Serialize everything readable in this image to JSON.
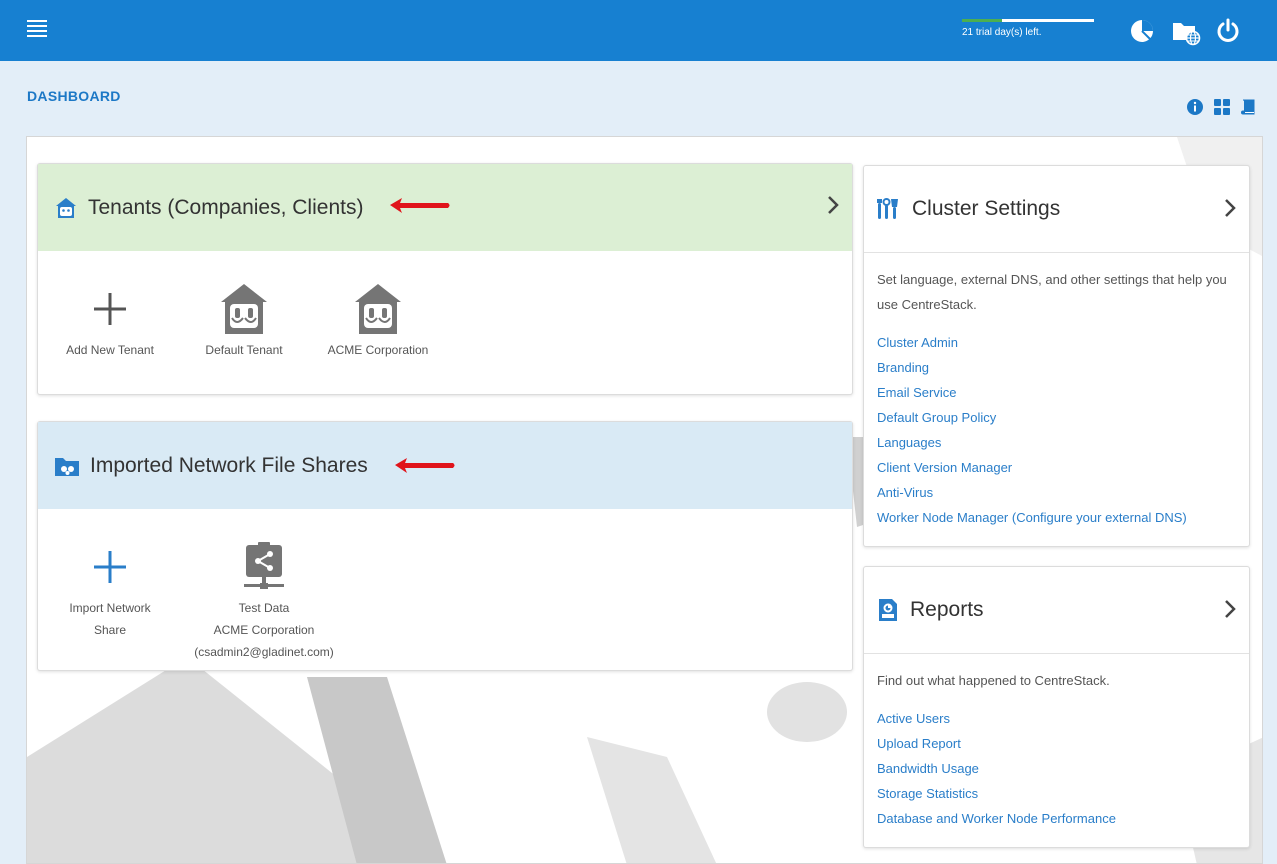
{
  "topbar": {
    "menu_icon": "hamburger-menu-icon",
    "trial_text": "21 trial day(s) left.",
    "trial_progress": 0.3,
    "icons": [
      "pie-chart-icon",
      "folder-globe-icon",
      "power-icon"
    ]
  },
  "page": {
    "title": "DASHBOARD",
    "view_icons": [
      "info-icon",
      "grid-view-icon",
      "book-icon"
    ]
  },
  "tenants": {
    "title": "Tenants (Companies, Clients)",
    "header_color": "#dcefd4",
    "tiles": [
      {
        "label": "Add New Tenant",
        "icon": "plus-icon"
      },
      {
        "label": "Default Tenant",
        "icon": "tenant-house-icon"
      },
      {
        "label": "ACME Corporation",
        "icon": "tenant-house-icon"
      }
    ]
  },
  "shares": {
    "title": "Imported Network File Shares",
    "header_color": "#d9eaf5",
    "tiles": [
      {
        "label_line1": "Import Network",
        "label_line2": "Share",
        "icon": "plus-icon"
      },
      {
        "label_line1": "Test Data",
        "label_line2": "ACME Corporation",
        "label_line3": "(csadmin2@gladinet.com)",
        "icon": "network-share-icon"
      }
    ]
  },
  "cluster": {
    "title": "Cluster Settings",
    "description": "Set language, external DNS, and other settings that help you use CentreStack.",
    "links": [
      "Cluster Admin",
      "Branding",
      "Email Service",
      "Default Group Policy",
      "Languages",
      "Client Version Manager",
      "Anti-Virus",
      "Worker Node Manager (Configure your external DNS)"
    ]
  },
  "reports": {
    "title": "Reports",
    "description": "Find out what happened to CentreStack.",
    "links": [
      "Active Users",
      "Upload Report",
      "Bandwidth Usage",
      "Storage Statistics",
      "Database and Worker Node Performance"
    ]
  },
  "colors": {
    "topbar": "#1780d1",
    "accent": "#1c78c6",
    "link": "#2a7ec9",
    "annotation_arrow": "#e0141b"
  }
}
